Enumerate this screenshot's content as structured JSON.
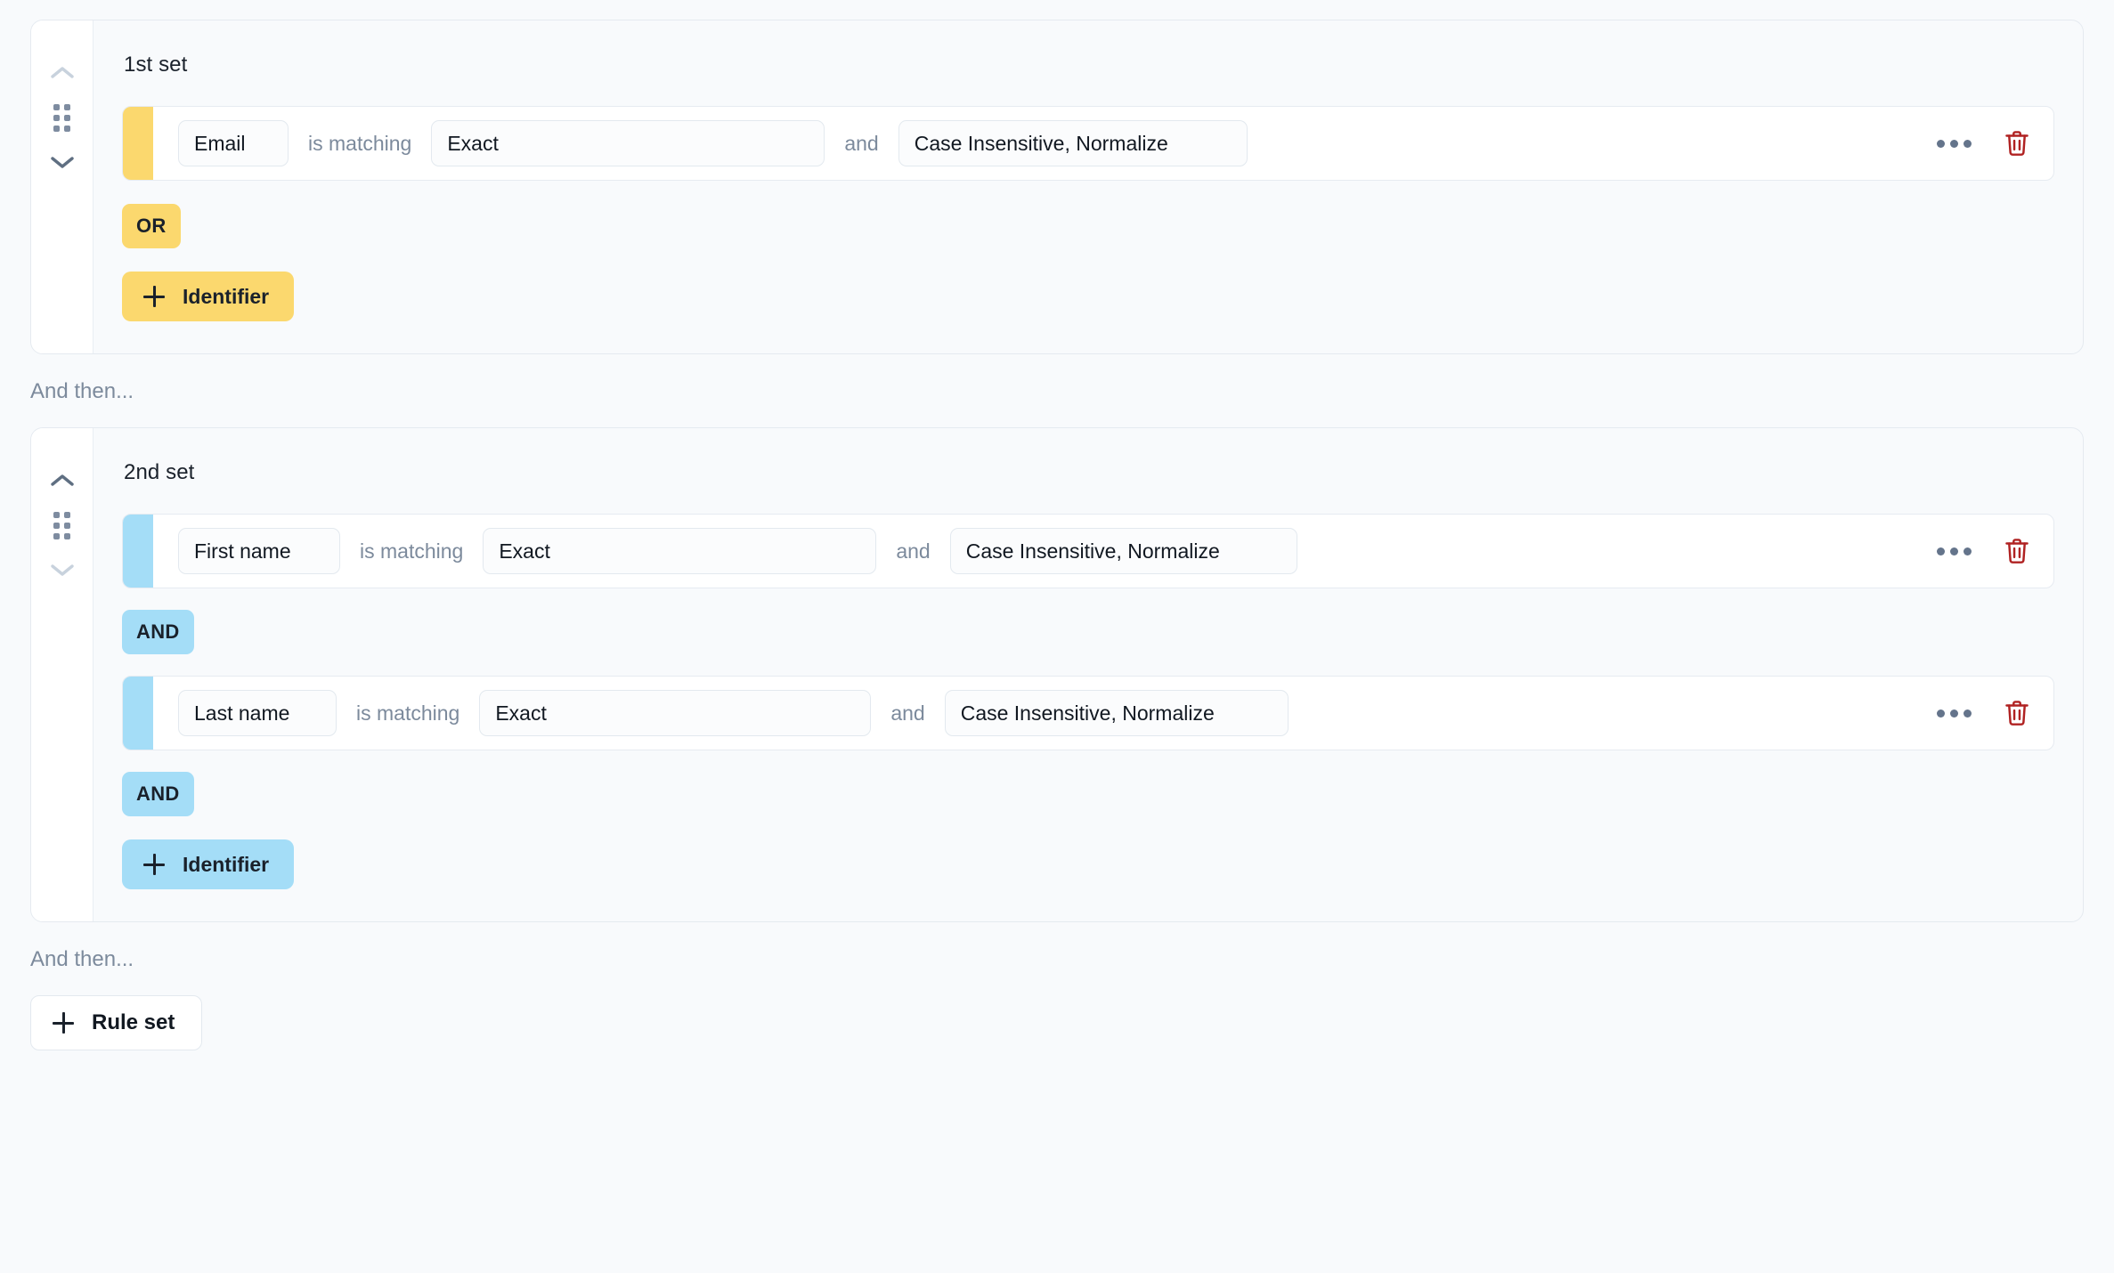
{
  "colors": {
    "page_background": "#F8FAFC",
    "accent_yellow": "#FBD86E",
    "accent_blue": "#A4DDF7",
    "delete_red": "#B02222",
    "muted_text": "#7C8A9C",
    "body_text": "#1A212B"
  },
  "labels": {
    "and_then": "And then...",
    "is_matching": "is matching",
    "and": "and",
    "add_identifier": "Identifier",
    "add_rule_set": "Rule set"
  },
  "icons": {
    "chevron_up": "chevron-up-icon",
    "chevron_down": "chevron-down-icon",
    "drag": "drag-handle-icon",
    "more": "more-options-icon",
    "delete": "trash-icon",
    "plus": "plus-icon"
  },
  "rule_sets": [
    {
      "title": "1st set",
      "accent": "yellow",
      "move_up_enabled": false,
      "move_down_enabled": true,
      "rules": [
        {
          "attribute": "Email",
          "operator_label": "is matching",
          "match_type": "Exact",
          "joiner_label": "and",
          "normalization": "Case Insensitive, Normalize"
        }
      ],
      "trailing_logic": "OR",
      "add_button_label": "Identifier"
    },
    {
      "title": "2nd set",
      "accent": "blue",
      "move_up_enabled": true,
      "move_down_enabled": false,
      "rules": [
        {
          "attribute": "First name",
          "operator_label": "is matching",
          "match_type": "Exact",
          "joiner_label": "and",
          "normalization": "Case Insensitive, Normalize"
        },
        {
          "attribute": "Last name",
          "operator_label": "is matching",
          "match_type": "Exact",
          "joiner_label": "and",
          "normalization": "Case Insensitive, Normalize"
        }
      ],
      "inner_logic": "AND",
      "trailing_logic": "AND",
      "add_button_label": "Identifier"
    }
  ],
  "footer": {
    "and_then": "And then...",
    "add_rule_set_label": "Rule set"
  }
}
